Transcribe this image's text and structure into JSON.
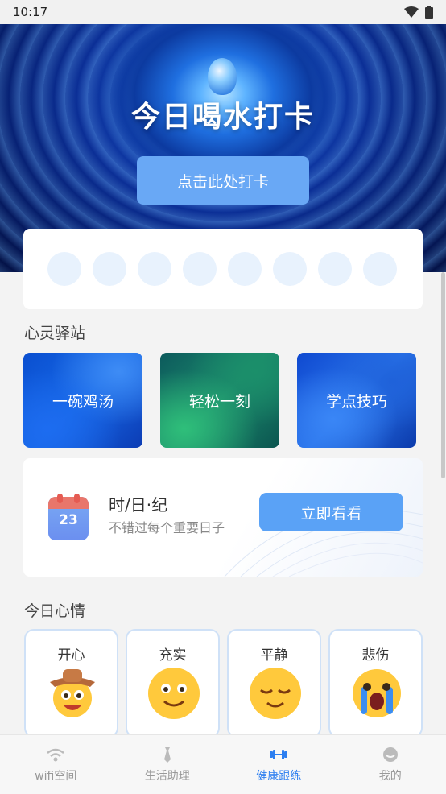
{
  "status_bar": {
    "time": "10:17"
  },
  "hero": {
    "title": "今日喝水打卡",
    "checkin_label": "点击此处打卡"
  },
  "water_dots": {
    "total": 8,
    "filled": 0
  },
  "sections": {
    "heart_station": "心灵驿站",
    "mood_today": "今日心情"
  },
  "tiles": [
    {
      "label": "一碗鸡汤"
    },
    {
      "label": "轻松一刻"
    },
    {
      "label": "学点技巧"
    }
  ],
  "calendar": {
    "day": "23",
    "title": "时/日·纪",
    "subtitle": "不错过每个重要日子",
    "button": "立即看看"
  },
  "moods": [
    {
      "label": "开心",
      "icon": "cowboy-face-icon"
    },
    {
      "label": "充实",
      "icon": "smiling-face-icon"
    },
    {
      "label": "平静",
      "icon": "relieved-face-icon"
    },
    {
      "label": "悲伤",
      "icon": "crying-face-icon"
    }
  ],
  "tab_bar": [
    {
      "label": "wifi空间",
      "icon": "wifi-icon",
      "active": false
    },
    {
      "label": "生活助理",
      "icon": "tie-icon",
      "active": false
    },
    {
      "label": "健康跟练",
      "icon": "dumbbell-icon",
      "active": true
    },
    {
      "label": "我的",
      "icon": "profile-icon",
      "active": false
    }
  ],
  "colors": {
    "accent": "#2c7ef0",
    "button_blue": "#5aa2f6",
    "dot": "#e8f2fd"
  }
}
